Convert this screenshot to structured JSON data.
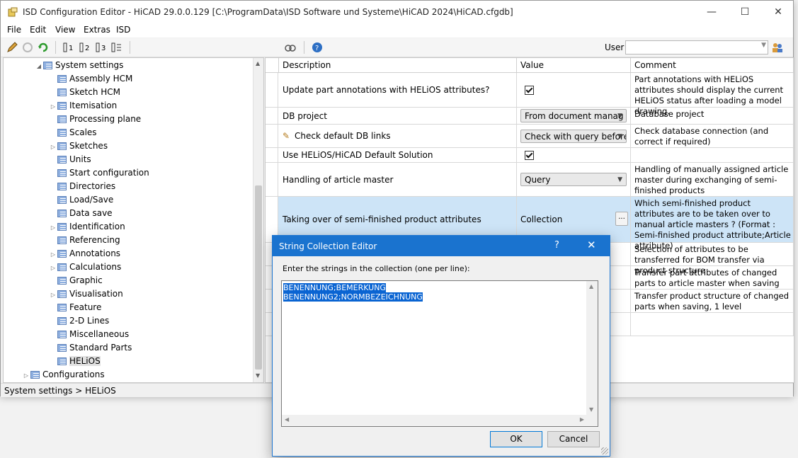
{
  "window": {
    "title": "ISD Configuration Editor  -  HiCAD 29.0.0.129 [C:\\ProgramData\\ISD Software und Systeme\\HiCAD 2024\\HiCAD.cfgdb]",
    "minimize": "—",
    "maximize": "☐",
    "close": "✕"
  },
  "menu": [
    "File",
    "Edit",
    "View",
    "Extras",
    "ISD"
  ],
  "toolbar": {
    "user_label": "User",
    "user_value": ""
  },
  "tree": {
    "root": "System settings",
    "items": [
      {
        "label": "Assembly HCM",
        "exp": ""
      },
      {
        "label": "Sketch HCM",
        "exp": ""
      },
      {
        "label": "Itemisation",
        "exp": "▷"
      },
      {
        "label": "Processing plane",
        "exp": ""
      },
      {
        "label": "Scales",
        "exp": ""
      },
      {
        "label": "Sketches",
        "exp": "▷"
      },
      {
        "label": "Units",
        "exp": ""
      },
      {
        "label": "Start configuration",
        "exp": ""
      },
      {
        "label": "Directories",
        "exp": ""
      },
      {
        "label": "Load/Save",
        "exp": ""
      },
      {
        "label": "Data save",
        "exp": ""
      },
      {
        "label": "Identification",
        "exp": "▷"
      },
      {
        "label": "Referencing",
        "exp": ""
      },
      {
        "label": "Annotations",
        "exp": "▷"
      },
      {
        "label": "Calculations",
        "exp": "▷"
      },
      {
        "label": "Graphic",
        "exp": ""
      },
      {
        "label": "Visualisation",
        "exp": "▷"
      },
      {
        "label": "Feature",
        "exp": ""
      },
      {
        "label": "2-D Lines",
        "exp": ""
      },
      {
        "label": "Miscellaneous",
        "exp": ""
      },
      {
        "label": "Standard Parts",
        "exp": ""
      },
      {
        "label": "HELiOS",
        "exp": ""
      }
    ],
    "configurations": "Configurations"
  },
  "status": "System settings > HELiOS",
  "grid": {
    "headers": [
      "Description",
      "Value",
      "Comment"
    ],
    "rows": [
      {
        "desc": "Update part annotations with HELiOS attributes?",
        "value": "",
        "comment": "Part annotations with HELiOS attributes should display the current HELiOS status after loading a model drawing."
      },
      {
        "desc": "DB project",
        "value": "From document manag",
        "comment": "Database project"
      },
      {
        "desc": "Check default DB links",
        "value": "Check with query before",
        "comment": "Check database connection (and correct if required)"
      },
      {
        "desc": "Use HELiOS/HiCAD Default Solution",
        "value": "",
        "comment": ""
      },
      {
        "desc": "Handling of article master",
        "value": "Query",
        "comment": "Handling of manually assigned article master during exchanging of semi-finished products"
      },
      {
        "desc": "Taking over of semi-finished product attributes",
        "value": "Collection",
        "comment": "Which semi-finished product attributes are to be taken over to manual article masters ? (Format : Semi-finished product attribute;Article attribute)"
      },
      {
        "desc": "",
        "value": "",
        "comment": "Selection of attributes to be transferred for BOM transfer via product structure"
      },
      {
        "desc": "",
        "value": "",
        "comment": "Transfer part attributes of changed parts to article master when saving"
      },
      {
        "desc": "",
        "value": "",
        "comment": "Transfer product structure of changed parts when saving, 1 level"
      }
    ],
    "ellipsis": "..."
  },
  "dialog": {
    "title": "String Collection Editor",
    "help": "?",
    "close": "✕",
    "prompt": "Enter the strings in the collection (one per line):",
    "lines": [
      "BENENNUNG;BEMERKUNG",
      "BENENNUNG2;NORMBEZEICHNUNG"
    ],
    "ok": "OK",
    "cancel": "Cancel"
  },
  "colors": {
    "accent": "#1a73cf",
    "selection": "#0a64d2",
    "row_selected": "#cde4f7"
  }
}
